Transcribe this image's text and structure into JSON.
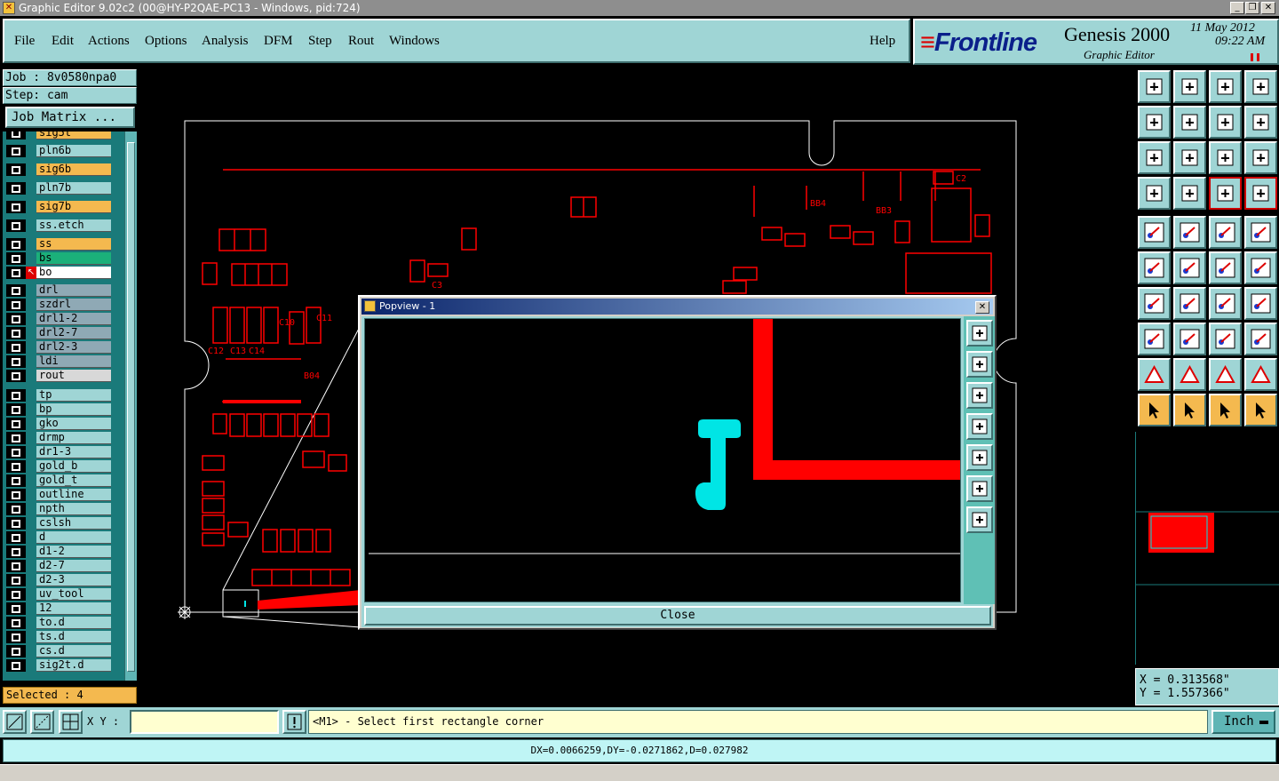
{
  "window": {
    "title": "Graphic Editor 9.02c2 (00@HY-P2QAE-PC13 - Windows, pid:724)"
  },
  "menu": [
    "File",
    "Edit",
    "Actions",
    "Options",
    "Analysis",
    "DFM",
    "Step",
    "Rout",
    "Windows"
  ],
  "help": "Help",
  "brand": {
    "logo": "Frontline",
    "product": "Genesis 2000",
    "subtitle": "Graphic Editor",
    "date": "11 May 2012",
    "time": "09:22 AM"
  },
  "job": {
    "job": "Job : 8v0580npa0",
    "step": "Step: cam",
    "matrix_button": "Job Matrix ..."
  },
  "layers": [
    {
      "name": "sig5t",
      "color": "#f4b94f"
    },
    {
      "name": "pln6b",
      "color": "#9fd5d5"
    },
    {
      "name": "sig6b",
      "color": "#f4b94f"
    },
    {
      "name": "pln7b",
      "color": "#9fd5d5"
    },
    {
      "name": "sig7b",
      "color": "#f4b94f"
    },
    {
      "name": "ss.etch",
      "color": "#9fd5d5"
    },
    {
      "name": "ss",
      "color": "#f4b94f"
    },
    {
      "name": "bs",
      "color": "#1bb07a"
    },
    {
      "name": "bo",
      "color": "#ffffff"
    },
    {
      "name": "drl",
      "color": "#8fa9b5"
    },
    {
      "name": "szdrl",
      "color": "#8fa9b5"
    },
    {
      "name": "drl1-2",
      "color": "#8fa9b5"
    },
    {
      "name": "drl2-7",
      "color": "#8fa9b5"
    },
    {
      "name": "drl2-3",
      "color": "#8fa9b5"
    },
    {
      "name": "ldi",
      "color": "#8fa9b5"
    },
    {
      "name": "rout",
      "color": "#d8d8d8"
    },
    {
      "name": "tp",
      "color": "#9fd5d5"
    },
    {
      "name": "bp",
      "color": "#9fd5d5"
    },
    {
      "name": "gko",
      "color": "#9fd5d5"
    },
    {
      "name": "drmp",
      "color": "#9fd5d5"
    },
    {
      "name": "dr1-3",
      "color": "#9fd5d5"
    },
    {
      "name": "gold_b",
      "color": "#9fd5d5"
    },
    {
      "name": "gold_t",
      "color": "#9fd5d5"
    },
    {
      "name": "outline",
      "color": "#9fd5d5"
    },
    {
      "name": "npth",
      "color": "#9fd5d5"
    },
    {
      "name": "cslsh",
      "color": "#9fd5d5"
    },
    {
      "name": "d",
      "color": "#9fd5d5"
    },
    {
      "name": "d1-2",
      "color": "#9fd5d5"
    },
    {
      "name": "d2-7",
      "color": "#9fd5d5"
    },
    {
      "name": "d2-3",
      "color": "#9fd5d5"
    },
    {
      "name": "uv_tool",
      "color": "#9fd5d5"
    },
    {
      "name": "12",
      "color": "#9fd5d5"
    },
    {
      "name": "to.d",
      "color": "#9fd5d5"
    },
    {
      "name": "ts.d",
      "color": "#9fd5d5"
    },
    {
      "name": "cs.d",
      "color": "#9fd5d5"
    },
    {
      "name": "sig2t.d",
      "color": "#9fd5d5"
    }
  ],
  "selected": "Selected : 4",
  "canvas_labels": {
    "c2": "C2",
    "bb4": "BB4",
    "bb3": "BB3",
    "c3": "C3",
    "c10": "C10",
    "c11": "C11",
    "c12": "C12",
    "c13": "C13",
    "c14": "C14",
    "b04": "B04"
  },
  "popview": {
    "title": "Popview - 1",
    "close_label": "Close"
  },
  "coords": {
    "x": "X = 0.313568\"",
    "y": "Y = 1.557366\""
  },
  "bottom": {
    "xy_label": "X Y :",
    "xy_value": "",
    "prompt": "<M1> - Select first rectangle corner",
    "units": "Inch"
  },
  "status": "DX=0.0066259,DY=-0.0271862,D=0.027982",
  "colors": {
    "panel": "#9fd5d5",
    "accent_orange": "#f4b94f",
    "pcb_red": "#ff0000",
    "feature_cyan": "#00e5e5"
  }
}
